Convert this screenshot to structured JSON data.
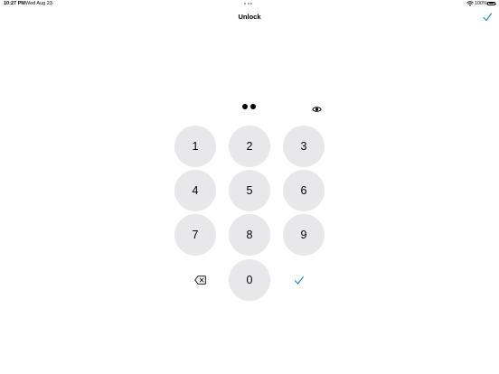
{
  "status_bar": {
    "time": "10:27 PM",
    "date": "Wed Aug 23",
    "battery_percent": "100%",
    "battery_level": 1.0,
    "wifi_icon": "wifi-icon",
    "battery_icon": "battery-full-icon"
  },
  "nav": {
    "title": "Unlock",
    "done_icon": "checkmark-icon"
  },
  "passcode": {
    "entered_count": 2,
    "reveal_icon": "eye-icon"
  },
  "keypad": {
    "keys": [
      "1",
      "2",
      "3",
      "4",
      "5",
      "6",
      "7",
      "8",
      "9",
      "0"
    ],
    "delete_icon": "delete-backward-icon",
    "confirm_icon": "checkmark-icon"
  },
  "colors": {
    "accent": "#1a8cd8",
    "key_background": "#e8e8ea",
    "text": "#000000"
  }
}
